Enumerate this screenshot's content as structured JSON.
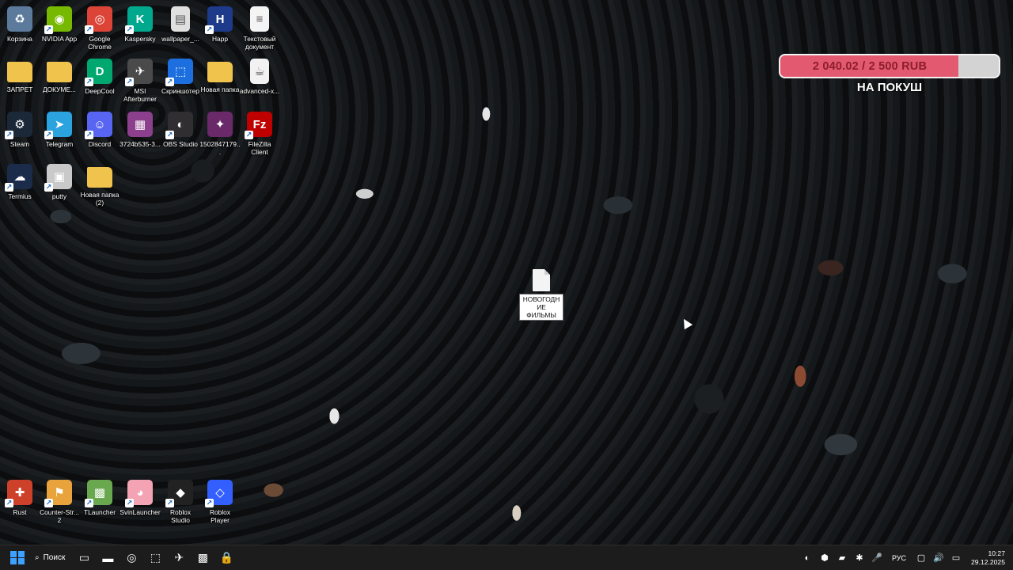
{
  "desktop": {
    "icons": [
      {
        "label": "Корзина",
        "icon": "recycle-bin-icon",
        "color": "#5c7a9c",
        "glyph": "♻",
        "shortcut": false
      },
      {
        "label": "NVIDIA App",
        "icon": "nvidia-icon",
        "color": "#76b900",
        "glyph": "◉",
        "shortcut": true
      },
      {
        "label": "Google Chrome",
        "icon": "chrome-icon",
        "color": "#db4437",
        "glyph": "◎",
        "shortcut": true
      },
      {
        "label": "Kaspersky",
        "icon": "kaspersky-icon",
        "color": "#00a88e",
        "glyph": "K",
        "shortcut": true
      },
      {
        "label": "wallpaper_...",
        "icon": "image-file-icon",
        "color": "#e0e0e0",
        "glyph": "▤",
        "shortcut": false
      },
      {
        "label": "Happ",
        "icon": "happ-icon",
        "color": "#1e3a8a",
        "glyph": "H",
        "shortcut": true
      },
      {
        "label": "Текстовый документ",
        "icon": "text-document-icon",
        "color": "#f4f4f4",
        "glyph": "≡",
        "shortcut": false
      },
      {
        "label": "ЗАПРЕТ",
        "icon": "folder-icon",
        "color": "#f0c34d",
        "glyph": "",
        "shortcut": false
      },
      {
        "label": "ДОКУМЕ...",
        "icon": "folder-icon",
        "color": "#f0c34d",
        "glyph": "",
        "shortcut": false
      },
      {
        "label": "DeepCool",
        "icon": "deepcool-icon",
        "color": "#00a870",
        "glyph": "D",
        "shortcut": true
      },
      {
        "label": "MSI Afterburner",
        "icon": "msi-afterburner-icon",
        "color": "#4a4a4a",
        "glyph": "✈",
        "shortcut": true
      },
      {
        "label": "Скриншотер",
        "icon": "screenshot-icon",
        "color": "#1d6fe0",
        "glyph": "⬚",
        "shortcut": true
      },
      {
        "label": "Новая папка",
        "icon": "folder-icon",
        "color": "#f0c34d",
        "glyph": "",
        "shortcut": false
      },
      {
        "label": "advanced-x...",
        "icon": "java-file-icon",
        "color": "#f2f2f2",
        "glyph": "☕",
        "shortcut": false
      },
      {
        "label": "Steam",
        "icon": "steam-icon",
        "color": "#1b2838",
        "glyph": "⚙",
        "shortcut": true
      },
      {
        "label": "Telegram",
        "icon": "telegram-icon",
        "color": "#2aa3df",
        "glyph": "➤",
        "shortcut": true
      },
      {
        "label": "Discord",
        "icon": "discord-icon",
        "color": "#5865f2",
        "glyph": "☺",
        "shortcut": true
      },
      {
        "label": "3724b535-3...",
        "icon": "winrar-archive-icon",
        "color": "#8b3f8c",
        "glyph": "▦",
        "shortcut": false
      },
      {
        "label": "OBS Studio",
        "icon": "obs-icon",
        "color": "#302e31",
        "glyph": "◐",
        "shortcut": true
      },
      {
        "label": "1502847179...",
        "icon": "video-file-icon",
        "color": "#6a2a6a",
        "glyph": "✦",
        "shortcut": false
      },
      {
        "label": "FileZilla Client",
        "icon": "filezilla-icon",
        "color": "#bf0000",
        "glyph": "Fz",
        "shortcut": true
      },
      {
        "label": "Termius",
        "icon": "termius-icon",
        "color": "#1b2b4a",
        "glyph": "☁",
        "shortcut": true
      },
      {
        "label": "putty",
        "icon": "putty-icon",
        "color": "#c9c9c9",
        "glyph": "▣",
        "shortcut": true
      },
      {
        "label": "Новая папка (2)",
        "icon": "folder-icon",
        "color": "#f0c34d",
        "glyph": "",
        "shortcut": false
      },
      {
        "label": "Rust",
        "icon": "rust-icon",
        "color": "#cd412b",
        "glyph": "✚",
        "shortcut": true
      },
      {
        "label": "Counter-Str... 2",
        "icon": "counter-strike-icon",
        "color": "#e8a33d",
        "glyph": "⚑",
        "shortcut": true
      },
      {
        "label": "TLauncher",
        "icon": "tlauncher-icon",
        "color": "#6aa84f",
        "glyph": "▩",
        "shortcut": true
      },
      {
        "label": "SvinLauncher",
        "icon": "svinlauncher-icon",
        "color": "#f4a3b4",
        "glyph": "◕",
        "shortcut": true
      },
      {
        "label": "Roblox Studio",
        "icon": "roblox-studio-icon",
        "color": "#222222",
        "glyph": "◆",
        "shortcut": true
      },
      {
        "label": "Roblox Player",
        "icon": "roblox-player-icon",
        "color": "#335fff",
        "glyph": "◇",
        "shortcut": true
      }
    ],
    "center_file": {
      "label": "НОВОГОДН ИЕ ФИЛЬМЫ",
      "icon": "text-document-icon"
    }
  },
  "widget": {
    "progress_text": "2 040.02 / 2 500 RUB",
    "current": 2040.02,
    "goal": 2500,
    "progress_fraction": 0.816,
    "caption": "НА ПОКУШ",
    "fill_color": "#e3596f"
  },
  "taskbar": {
    "search_label": "Поиск",
    "pinned": [
      {
        "icon": "task-view-icon",
        "glyph": "▭"
      },
      {
        "icon": "file-explorer-icon",
        "glyph": "▬"
      },
      {
        "icon": "chrome-icon",
        "glyph": "◎"
      },
      {
        "icon": "screenshot-icon",
        "glyph": "⬚"
      },
      {
        "icon": "msi-afterburner-icon",
        "glyph": "✈"
      },
      {
        "icon": "tlauncher-icon",
        "glyph": "▩"
      },
      {
        "icon": "lock-icon",
        "glyph": "🔒"
      }
    ],
    "tray": [
      {
        "icon": "obs-tray-icon",
        "glyph": "◐"
      },
      {
        "icon": "kaspersky-tray-icon",
        "glyph": "⬢"
      },
      {
        "icon": "nvidia-tray-icon",
        "glyph": "▰"
      },
      {
        "icon": "bluetooth-tray-icon",
        "glyph": "✱"
      },
      {
        "icon": "microphone-tray-icon",
        "glyph": "🎤"
      }
    ],
    "language": "РУС",
    "system_icons": [
      {
        "icon": "display-icon",
        "glyph": "▢"
      },
      {
        "icon": "volume-icon",
        "glyph": "🔊"
      },
      {
        "icon": "battery-icon",
        "glyph": "▭"
      }
    ],
    "time": "10:27",
    "date": "29.12.2025"
  }
}
